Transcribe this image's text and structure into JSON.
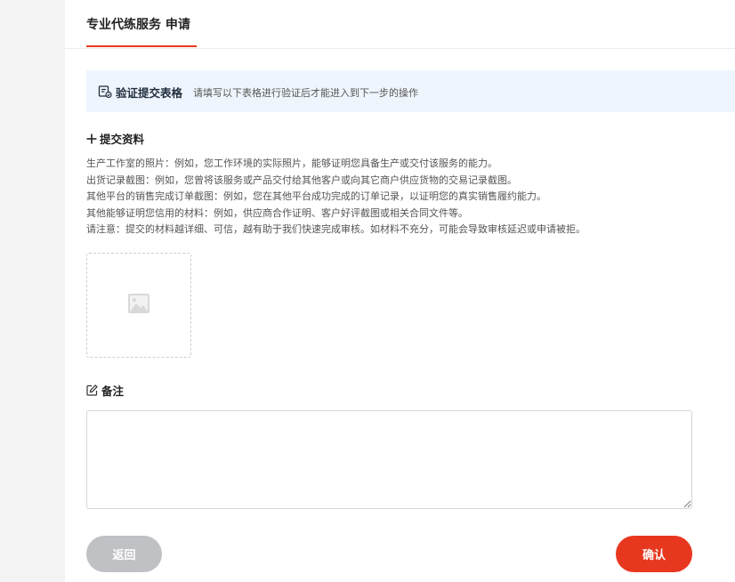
{
  "header": {
    "tab_title": "专业代练服务 申请"
  },
  "notice": {
    "icon": "form-check-icon",
    "title": "验证提交表格",
    "text": "请填写以下表格进行验证后才能进入到下一步的操作"
  },
  "submit_section": {
    "icon": "plus-icon",
    "heading": "提交资料",
    "lines": [
      "生产工作室的照片：例如，您工作环境的实际照片，能够证明您具备生产或交付该服务的能力。",
      "出货记录截图：例如，您曾将该服务或产品交付给其他客户或向其它商户供应货物的交易记录截图。",
      "其他平台的销售完成订单截图：例如，您在其他平台成功完成的订单记录，以证明您的真实销售履约能力。",
      "其他能够证明您信用的材料：例如，供应商合作证明、客户好评截图或相关合同文件等。",
      "请注意：提交的材料越详细、可信，越有助于我们快速完成审核。如材料不充分，可能会导致审核延迟或申请被拒。"
    ],
    "upload_icon": "image-placeholder-icon"
  },
  "remark_section": {
    "icon": "edit-icon",
    "heading": "备注",
    "value": "",
    "placeholder": ""
  },
  "actions": {
    "back_label": "返回",
    "confirm_label": "确认"
  },
  "colors": {
    "accent": "#e8391f",
    "notice_bg": "#eff5fc",
    "back_button": "#c0c1c5",
    "page_bg": "#f4f4f5"
  }
}
